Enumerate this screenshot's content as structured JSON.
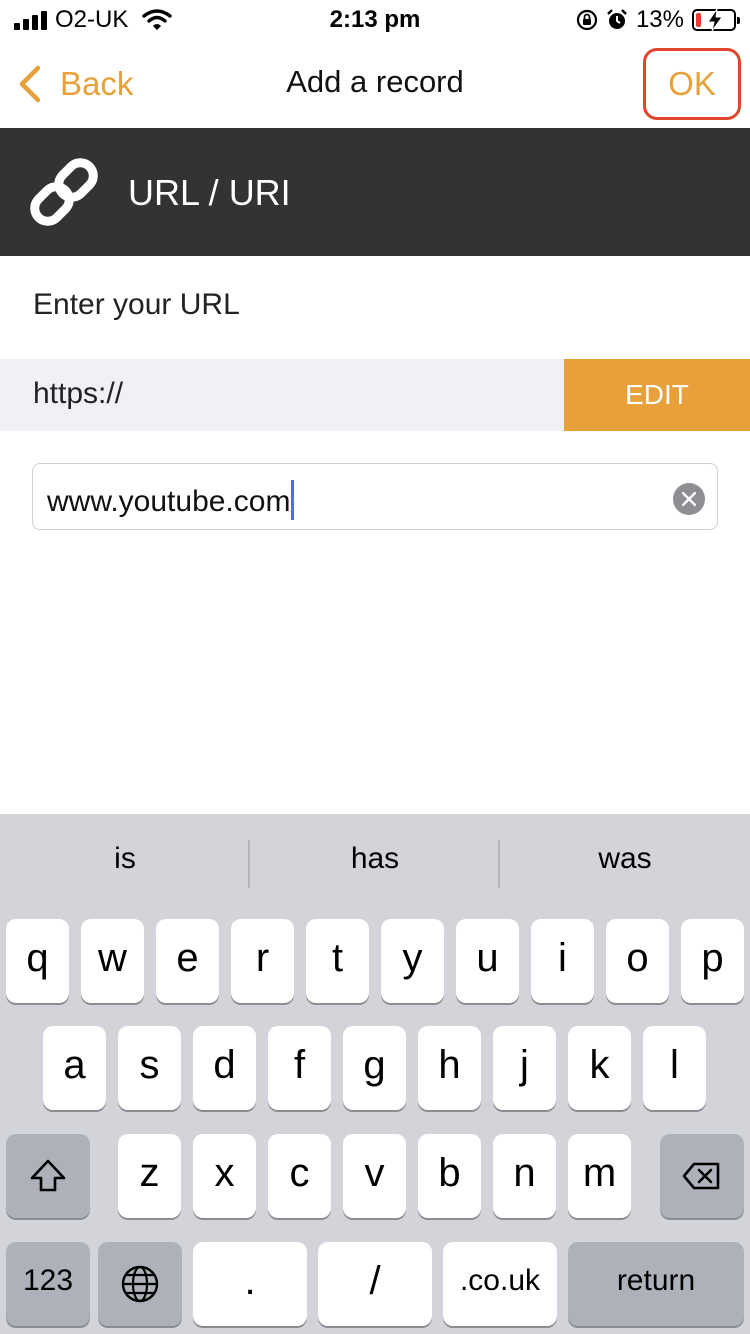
{
  "status_bar": {
    "carrier": "O2-UK",
    "time": "2:13 pm",
    "battery_percent": "13%",
    "battery_level": 0.13,
    "icons": [
      "signal-icon",
      "wifi-icon",
      "rotation-lock-icon",
      "alarm-icon",
      "battery-charging-icon"
    ]
  },
  "nav": {
    "back_label": "Back",
    "title": "Add a record",
    "ok_label": "OK"
  },
  "record_type": {
    "icon": "link-icon",
    "title": "URL / URI"
  },
  "form": {
    "prompt": "Enter your URL",
    "prefix": "https://",
    "edit_label": "EDIT",
    "url_value": "www.youtube.com"
  },
  "keyboard": {
    "suggestions": [
      "is",
      "has",
      "was"
    ],
    "row1": [
      "q",
      "w",
      "e",
      "r",
      "t",
      "y",
      "u",
      "i",
      "o",
      "p"
    ],
    "row2": [
      "a",
      "s",
      "d",
      "f",
      "g",
      "h",
      "j",
      "k",
      "l"
    ],
    "row3": [
      "z",
      "x",
      "c",
      "v",
      "b",
      "n",
      "m"
    ],
    "numbers_label": "123",
    "dot_label": ".",
    "slash_label": "/",
    "domain_label": ".co.uk",
    "return_label": "return"
  },
  "colors": {
    "accent": "#e8a03b",
    "highlight_border": "#e0452f",
    "header_bg": "#333333",
    "keyboard_bg": "#d2d4da",
    "caret": "#3478f6",
    "battery_low": "#e63b2e"
  }
}
